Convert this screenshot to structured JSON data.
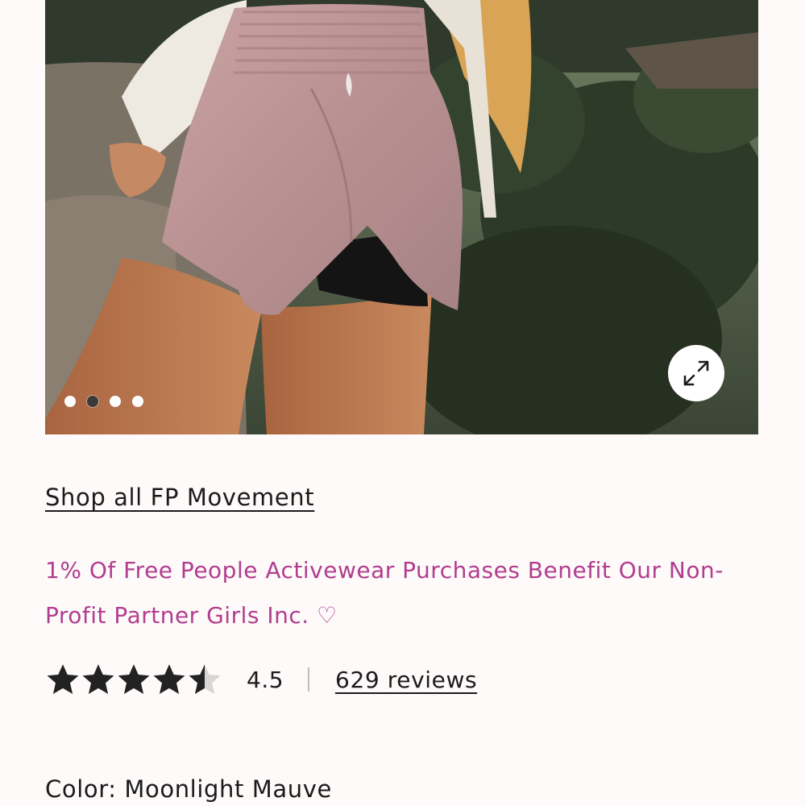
{
  "product": {
    "image": {
      "alt_icon": "product-photo",
      "dots": [
        {
          "active": false
        },
        {
          "active": true
        },
        {
          "active": false
        },
        {
          "active": false
        }
      ],
      "expand_icon": "expand-icon"
    },
    "shop_link_label": "Shop all FP Movement",
    "promo_text": "1% Of Free People Activewear Purchases Benefit Our Non-Profit Partner Girls Inc. ♡",
    "rating": {
      "value_text": "4.5",
      "value": 4.5,
      "max": 5,
      "reviews_label": "629 reviews"
    },
    "color_label": "Color: Moonlight Mauve"
  },
  "colors": {
    "accent_pink": "#b23d8f",
    "text": "#1b1b1b",
    "background": "#fdfaf9"
  }
}
